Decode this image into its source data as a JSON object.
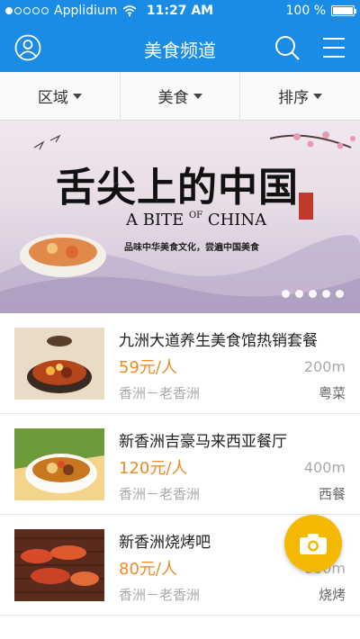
{
  "status_bar": {
    "carrier": "Applidium",
    "time": "11:27 AM",
    "battery": "100 %",
    "signal_icon": "signal-dots-icon",
    "wifi_icon": "wifi-icon",
    "battery_icon": "battery-icon"
  },
  "nav": {
    "title": "美食频道",
    "left_icon": "profile-icon",
    "right_icons": [
      "search-icon",
      "menu-icon"
    ]
  },
  "filters": [
    {
      "label": "区域"
    },
    {
      "label": "美食"
    },
    {
      "label": "排序"
    }
  ],
  "banner": {
    "title": "舌尖上的中国",
    "subtitle_a": "A BITE",
    "subtitle_of": "OF",
    "subtitle_b": "CHINA",
    "tagline": "品味中华美食文化，尝遍中国美食",
    "pages": 5,
    "active_page": 1
  },
  "restaurants": [
    {
      "name": "九洲大道养生美食馆热销套餐",
      "price": "59元/人",
      "distance": "200m",
      "location": "香洲－老香洲",
      "category": "粤菜"
    },
    {
      "name": "新香洲吉豪马来西亚餐厅",
      "price": "120元/人",
      "distance": "400m",
      "location": "香洲－老香洲",
      "category": "西餐"
    },
    {
      "name": "新香洲烧烤吧",
      "price": "80元/人",
      "distance": "800m",
      "location": "香洲－老香洲",
      "category": "烧烤"
    }
  ],
  "fab": {
    "icon": "camera-icon"
  },
  "colors": {
    "primary": "#1a8ce6",
    "price": "#f08a24",
    "fab": "#f5b800"
  }
}
